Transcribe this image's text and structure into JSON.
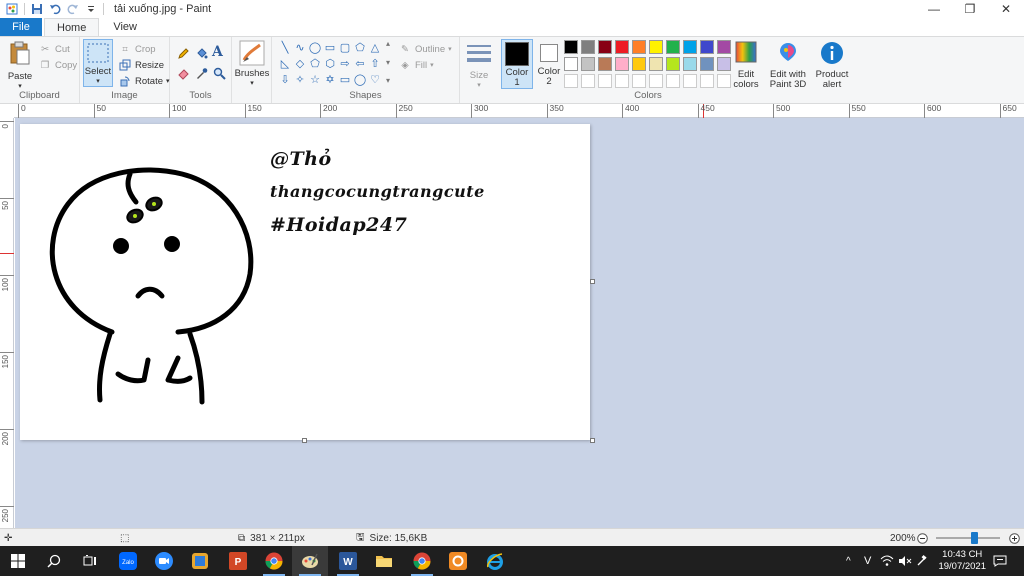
{
  "window": {
    "title": "tải xuống.jpg - Paint",
    "minimize": "—",
    "maximize": "❐",
    "close": "✕"
  },
  "tabs": {
    "file": "File",
    "home": "Home",
    "view": "View"
  },
  "ribbon": {
    "clipboard": {
      "label": "Clipboard",
      "paste": "Paste",
      "cut": "Cut",
      "copy": "Copy"
    },
    "image": {
      "label": "Image",
      "select": "Select",
      "crop": "Crop",
      "resize": "Resize",
      "rotate": "Rotate"
    },
    "tools": {
      "label": "Tools"
    },
    "brushes": {
      "label": "Brushes"
    },
    "shapes": {
      "label": "Shapes",
      "outline": "Outline",
      "fill": "Fill"
    },
    "size": {
      "label": "Size"
    },
    "color1": {
      "label1": "Color",
      "label2": "1",
      "value": "#000000"
    },
    "color2": {
      "label1": "Color",
      "label2": "2",
      "value": "#ffffff"
    },
    "colors": {
      "label": "Colors",
      "palette": [
        "#000000",
        "#7f7f7f",
        "#880015",
        "#ed1c24",
        "#ff7f27",
        "#fff200",
        "#22b14c",
        "#00a2e8",
        "#3f48cc",
        "#a349a4",
        "#ffffff",
        "#c3c3c3",
        "#b97a57",
        "#ffaec9",
        "#ffc90e",
        "#efe4b0",
        "#b5e61d",
        "#99d9ea",
        "#7092be",
        "#c8bfe7"
      ]
    },
    "edit_colors": {
      "line1": "Edit",
      "line2": "colors"
    },
    "paint3d": {
      "line1": "Edit with",
      "line2": "Paint 3D"
    },
    "product_alert": {
      "line1": "Product",
      "line2": "alert"
    }
  },
  "ruler": {
    "h": [
      "0",
      "50",
      "100",
      "150",
      "200",
      "250",
      "300",
      "350",
      "400",
      "450",
      "500",
      "550",
      "600",
      "650"
    ],
    "v": [
      "0",
      "50",
      "100",
      "150",
      "200",
      "250"
    ]
  },
  "canvas": {
    "line1": "@Thỏ",
    "line2": "thangcocungtrangcute",
    "line3": "#Hoidap247"
  },
  "status": {
    "dimensions": "381 × 211px",
    "size": "Size: 15,6KB",
    "zoom": "200%",
    "zoom_level": 0.5
  },
  "taskbar": {
    "time": "10:43 CH",
    "date": "19/07/2021",
    "lang": "V",
    "chevron": "^"
  }
}
